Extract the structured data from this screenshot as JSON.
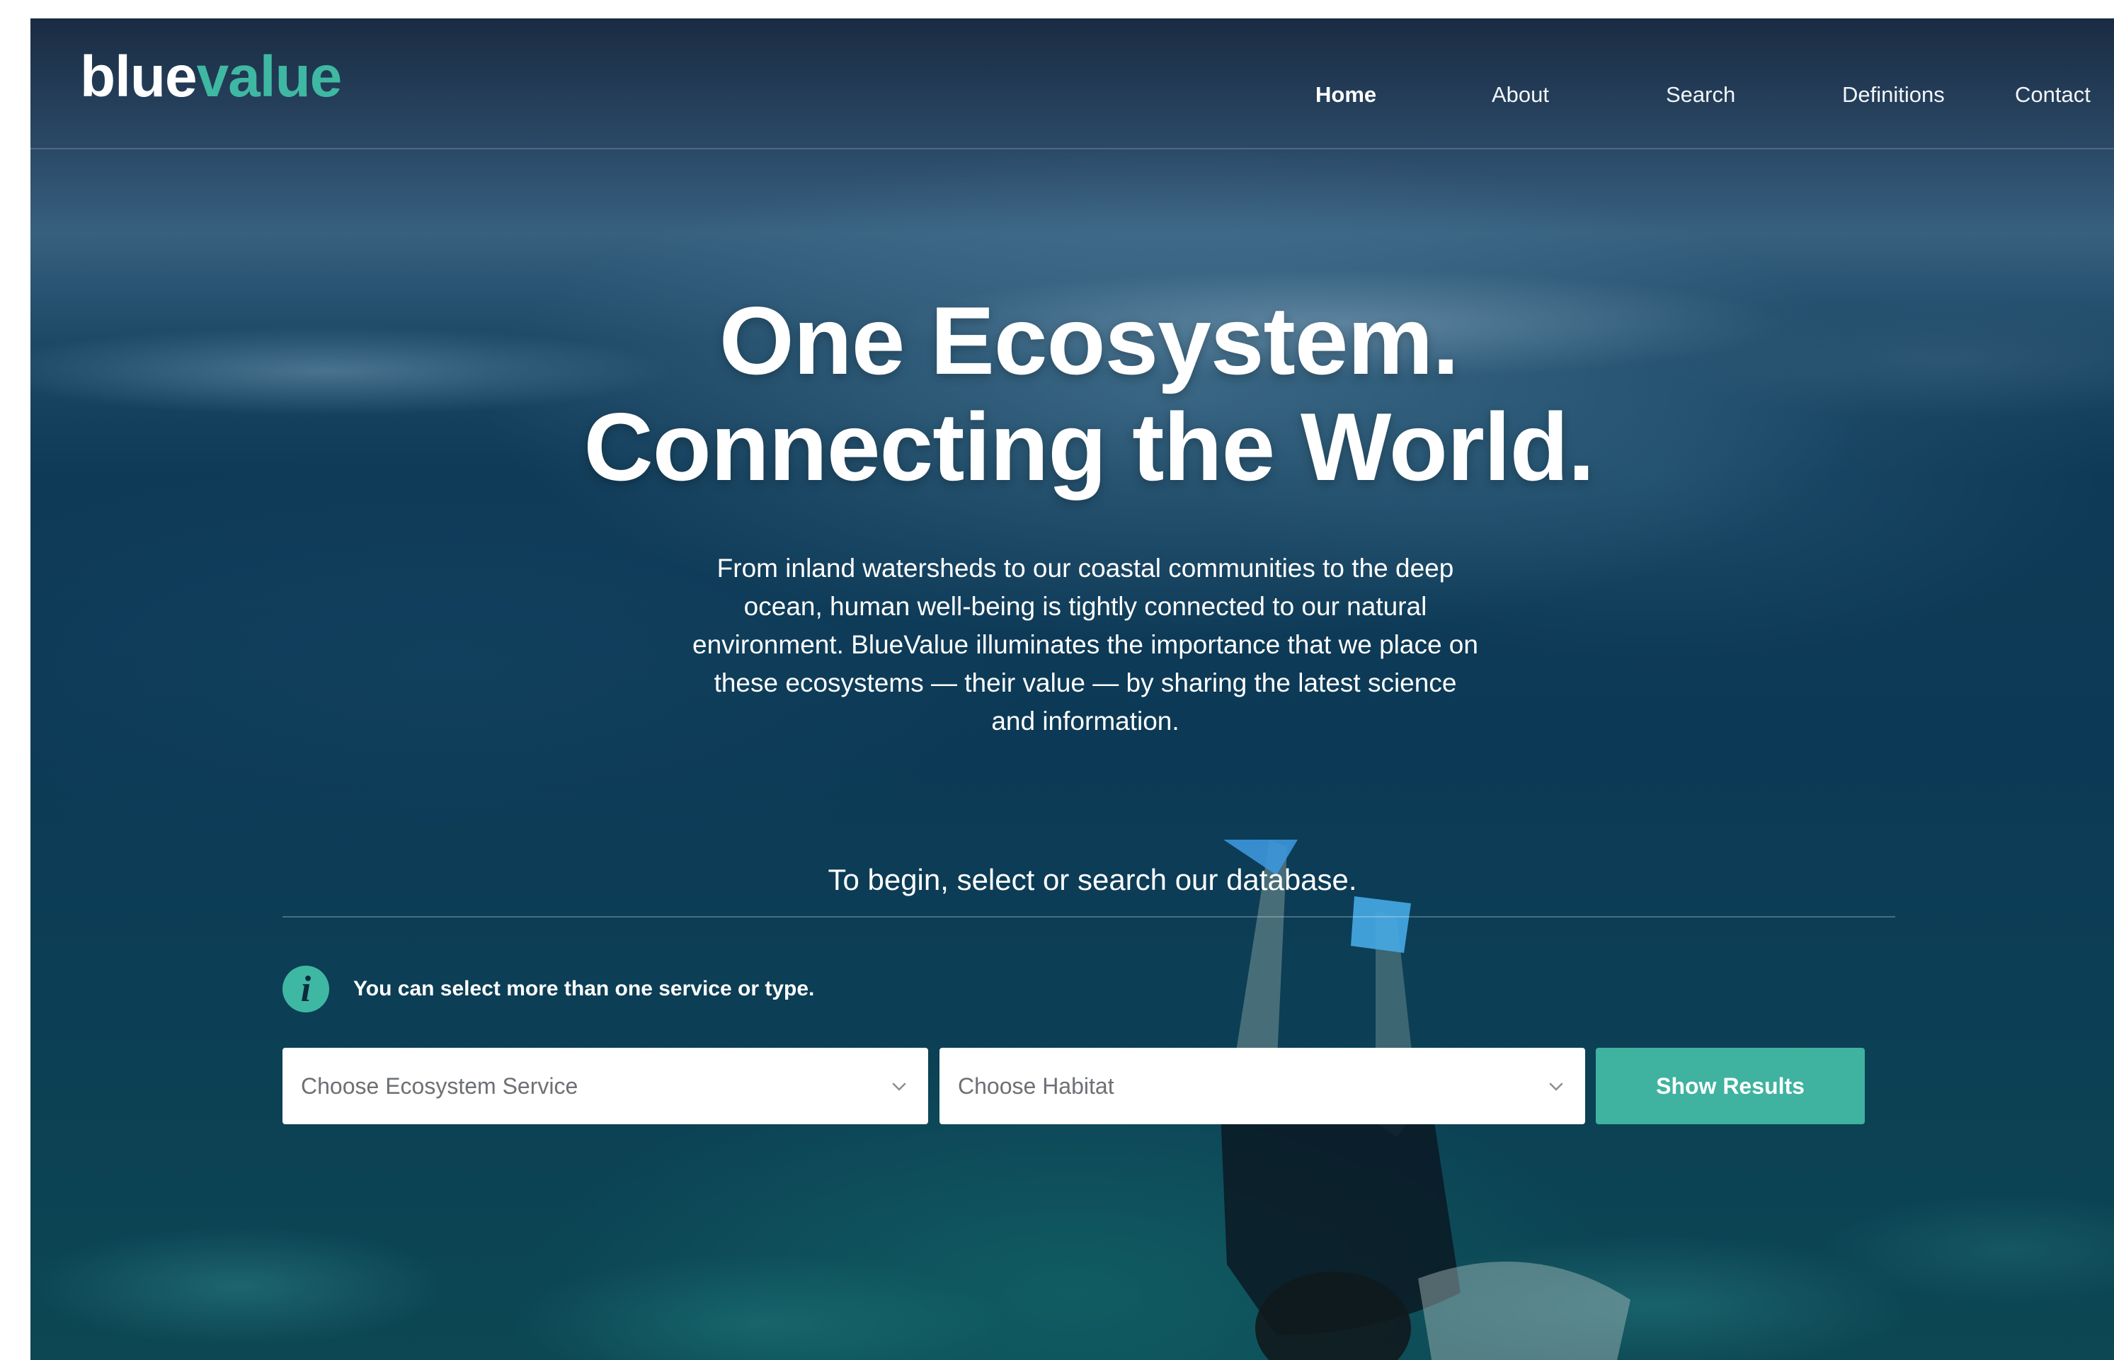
{
  "brand": {
    "part1": "blue",
    "part2": "value",
    "color_accent": "#3fb8a3"
  },
  "nav": {
    "items": [
      {
        "label": "Home",
        "active": true
      },
      {
        "label": "About"
      },
      {
        "label": "Search"
      },
      {
        "label": "Definitions"
      },
      {
        "label": "Contact"
      }
    ]
  },
  "hero": {
    "title_line1": "One Ecosystem.",
    "title_line2": "Connecting the World.",
    "description": "From inland watersheds to our coastal communities to the deep ocean, human well-being is tightly connected to our natural environment. BlueValue illuminates the importance that we place on these ecosystems — their value — by sharing the latest science and information.",
    "prompt": "To begin, select or search our database."
  },
  "search": {
    "info_icon": "info-icon",
    "info_text": "You can select more than one service or type.",
    "service_placeholder": "Choose Ecosystem Service",
    "habitat_placeholder": "Choose Habitat",
    "button_label": "Show Results",
    "button_color": "#3fb2a0"
  }
}
